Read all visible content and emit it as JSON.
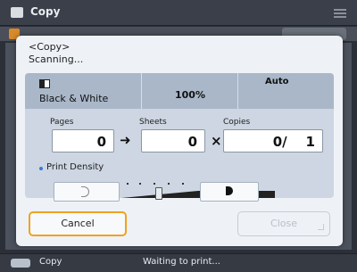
{
  "header": {
    "title": "Copy"
  },
  "dialog": {
    "title": "<Copy>",
    "status": "Scanning...",
    "summary": {
      "color_mode": "Black & White",
      "ratio": "100%",
      "paper": "Auto"
    },
    "pages": {
      "label": "Pages",
      "value": "0"
    },
    "sheets": {
      "label": "Sheets",
      "value": "0"
    },
    "copies": {
      "label": "Copies",
      "value": "0/    1"
    },
    "print_density": {
      "label": "Print Density",
      "level_fraction": 0.5
    },
    "cancel_label": "Cancel",
    "close_label": "Close"
  },
  "footer": {
    "device_label": "Copy",
    "status_text": "Waiting to print..."
  },
  "colors": {
    "accent": "#f1a21f",
    "density_dot": "#3a79d8"
  }
}
